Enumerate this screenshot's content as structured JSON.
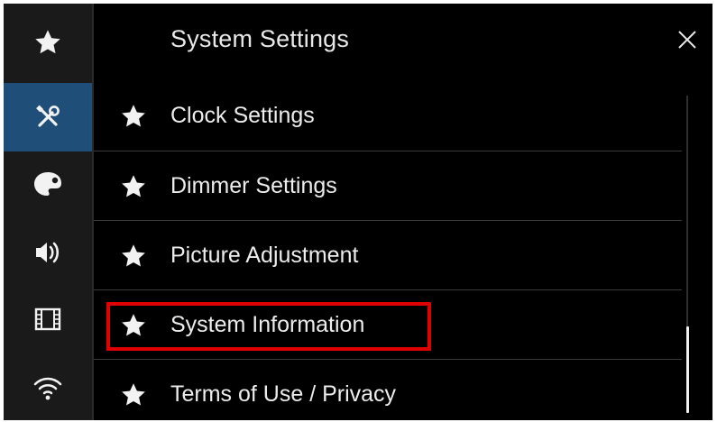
{
  "header": {
    "title": "System Settings",
    "close_icon": "close-icon"
  },
  "sidebar": {
    "items": [
      {
        "icon": "star-icon",
        "active": false
      },
      {
        "icon": "tools-icon",
        "active": true
      },
      {
        "icon": "palette-icon",
        "active": false
      },
      {
        "icon": "speaker-icon",
        "active": false
      },
      {
        "icon": "film-icon",
        "active": false
      },
      {
        "icon": "wifi-icon",
        "active": false
      }
    ]
  },
  "list": {
    "items": [
      {
        "label": "Clock Settings",
        "icon": "star-icon"
      },
      {
        "label": "Dimmer Settings",
        "icon": "star-icon"
      },
      {
        "label": "Picture Adjustment",
        "icon": "star-icon"
      },
      {
        "label": "System Information",
        "icon": "star-icon",
        "highlighted": true
      },
      {
        "label": "Terms of Use / Privacy",
        "icon": "star-icon"
      }
    ]
  },
  "colors": {
    "background": "#000000",
    "sidebar": "#1a1a1a",
    "active": "#1f4e79",
    "highlight": "#e00000",
    "text": "#ececec"
  }
}
